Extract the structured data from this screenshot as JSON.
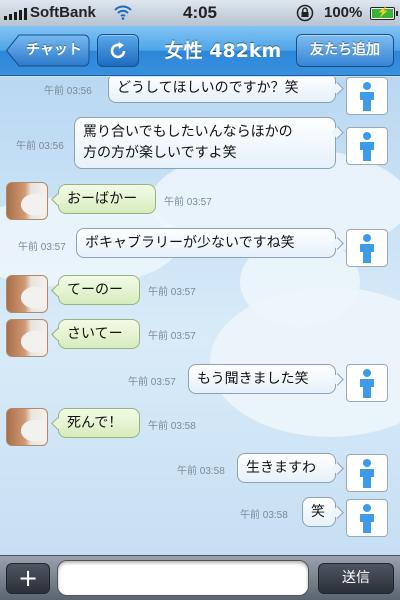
{
  "status_bar": {
    "carrier": "SoftBank",
    "time": "4:05",
    "battery_percent": "100%",
    "icons": [
      "signal-icon",
      "wifi-icon",
      "rotation-lock-icon",
      "battery-icon"
    ]
  },
  "nav": {
    "back_label": "チャット",
    "title": "女性 482km",
    "add_friend_label": "友たち追加",
    "icons": [
      "refresh-icon"
    ]
  },
  "colors": {
    "nav_blue": "#3990de",
    "my_bubble": "#e6f1fa",
    "their_bubble": "#d6ecbd",
    "toolbar": "#5b6571"
  },
  "messages": [
    {
      "sender": "me",
      "time": "午前 03:56",
      "text": "どうしてほしいのですか？笑"
    },
    {
      "sender": "me",
      "time": "午前 03:56",
      "lines": [
        "罵り合いでもしたいんならほかの",
        "方の方が楽しいですよ笑"
      ]
    },
    {
      "sender": "them",
      "time": "午前 03:57",
      "text": "おーばかー"
    },
    {
      "sender": "me",
      "time": "午前 03:57",
      "text": "ボキャブラリーが少ないですね笑"
    },
    {
      "sender": "them",
      "time": "午前 03:57",
      "text": "てーのー"
    },
    {
      "sender": "them",
      "time": "午前 03:57",
      "text": "さいてー"
    },
    {
      "sender": "me",
      "time": "午前 03:57",
      "text": "もう聞きました笑"
    },
    {
      "sender": "them",
      "time": "午前 03:58",
      "text": "死んで！"
    },
    {
      "sender": "me",
      "time": "午前 03:58",
      "text": "生きますわ"
    },
    {
      "sender": "me",
      "time": "午前 03:58",
      "text": "笑"
    }
  ],
  "toolbar": {
    "plus_label": "+",
    "input_value": "",
    "send_label": "送信"
  }
}
